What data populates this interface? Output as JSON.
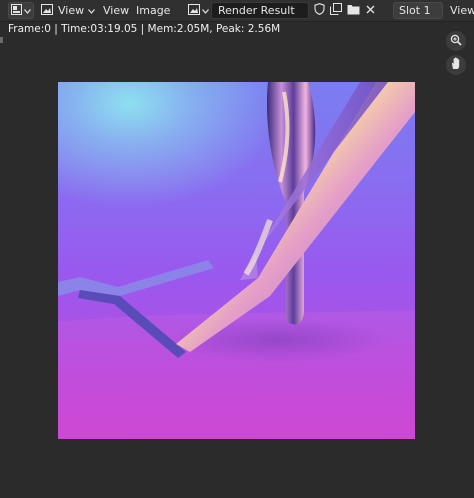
{
  "header": {
    "view_menu_1": "View",
    "view_menu_2": "View",
    "image_menu": "Image",
    "image_name": "Render Result",
    "slot": "Slot 1",
    "view_menu_3": "View"
  },
  "info_bar": {
    "text": "Frame:0 | Time:03:19.05 | Mem:2.05M, Peak: 2.56M"
  },
  "icons": [
    "editor-type-icon",
    "display-mode-icon",
    "chevron-down-icon",
    "image-browse-icon",
    "fake-user-shield-icon",
    "duplicate-image-icon",
    "open-folder-icon",
    "close-icon",
    "zoom-icon",
    "hand-pan-icon"
  ],
  "colors": {
    "header_bg": "#303030",
    "viewport_bg": "#2b2b2b",
    "field_bg": "#1d1d1d"
  }
}
